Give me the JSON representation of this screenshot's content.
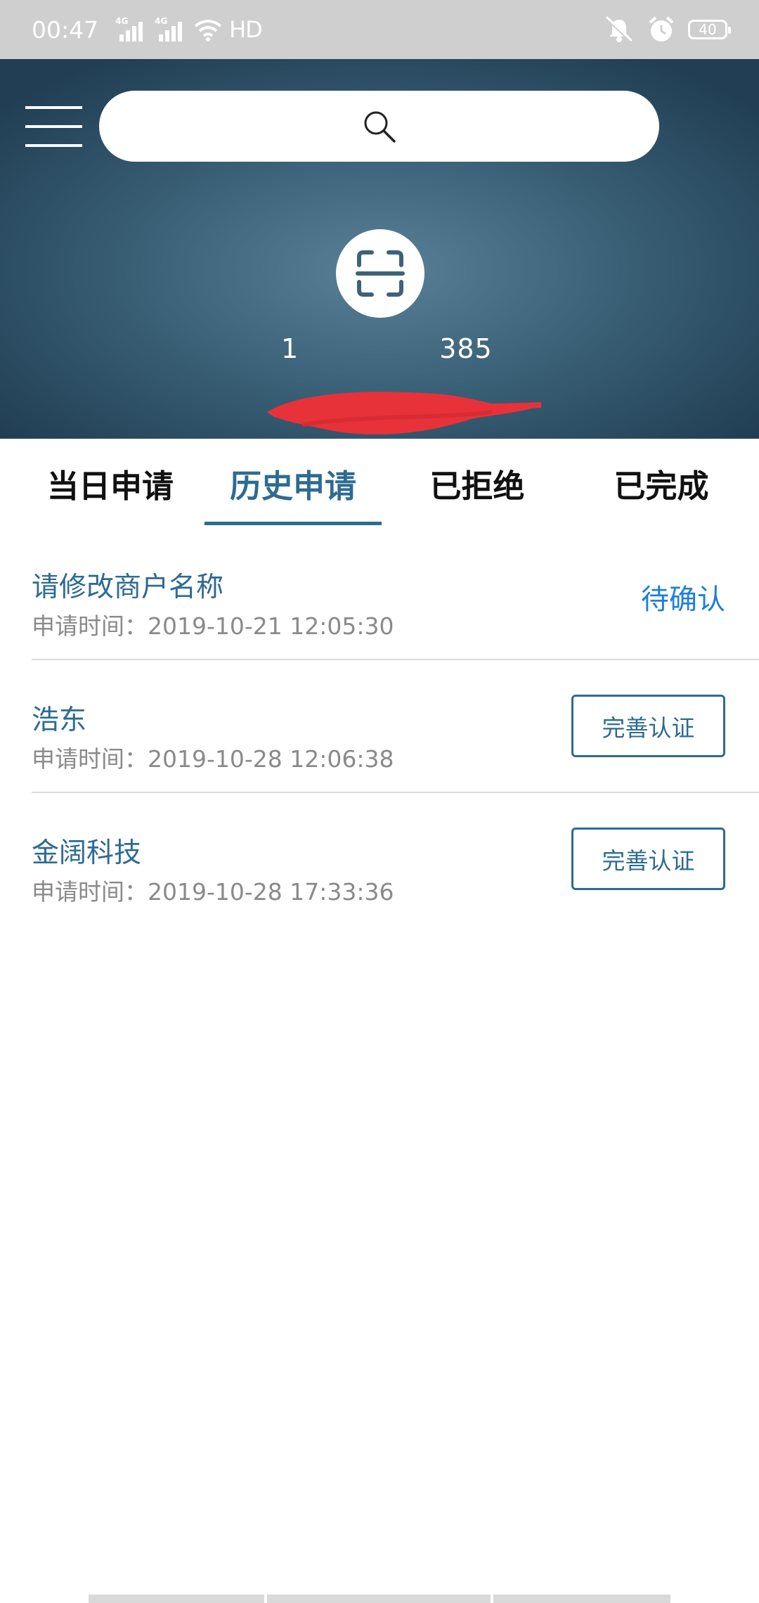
{
  "status_bar": {
    "time": "00:47",
    "network_1": "4G",
    "network_2": "4G",
    "hd": "HD",
    "battery": "40"
  },
  "header": {
    "account_text": "1",
    "account_suffix": "385"
  },
  "tabs": [
    {
      "label": "当日申请",
      "active": false
    },
    {
      "label": "历史申请",
      "active": true
    },
    {
      "label": "已拒绝",
      "active": false
    },
    {
      "label": "已完成",
      "active": false
    }
  ],
  "list": [
    {
      "title": "请修改商户名称",
      "time": "申请时间：2019-10-21 12:05:30",
      "status": "待确认"
    },
    {
      "title": "浩东",
      "time": "申请时间：2019-10-28 12:06:38",
      "action": "完善认证"
    },
    {
      "title": "金阔科技",
      "time": "申请时间：2019-10-28 17:33:36",
      "action": "完善认证"
    }
  ],
  "colors": {
    "accent": "#2e6b91",
    "pending": "#1f7fd6",
    "header_bg": "#3c6379"
  }
}
